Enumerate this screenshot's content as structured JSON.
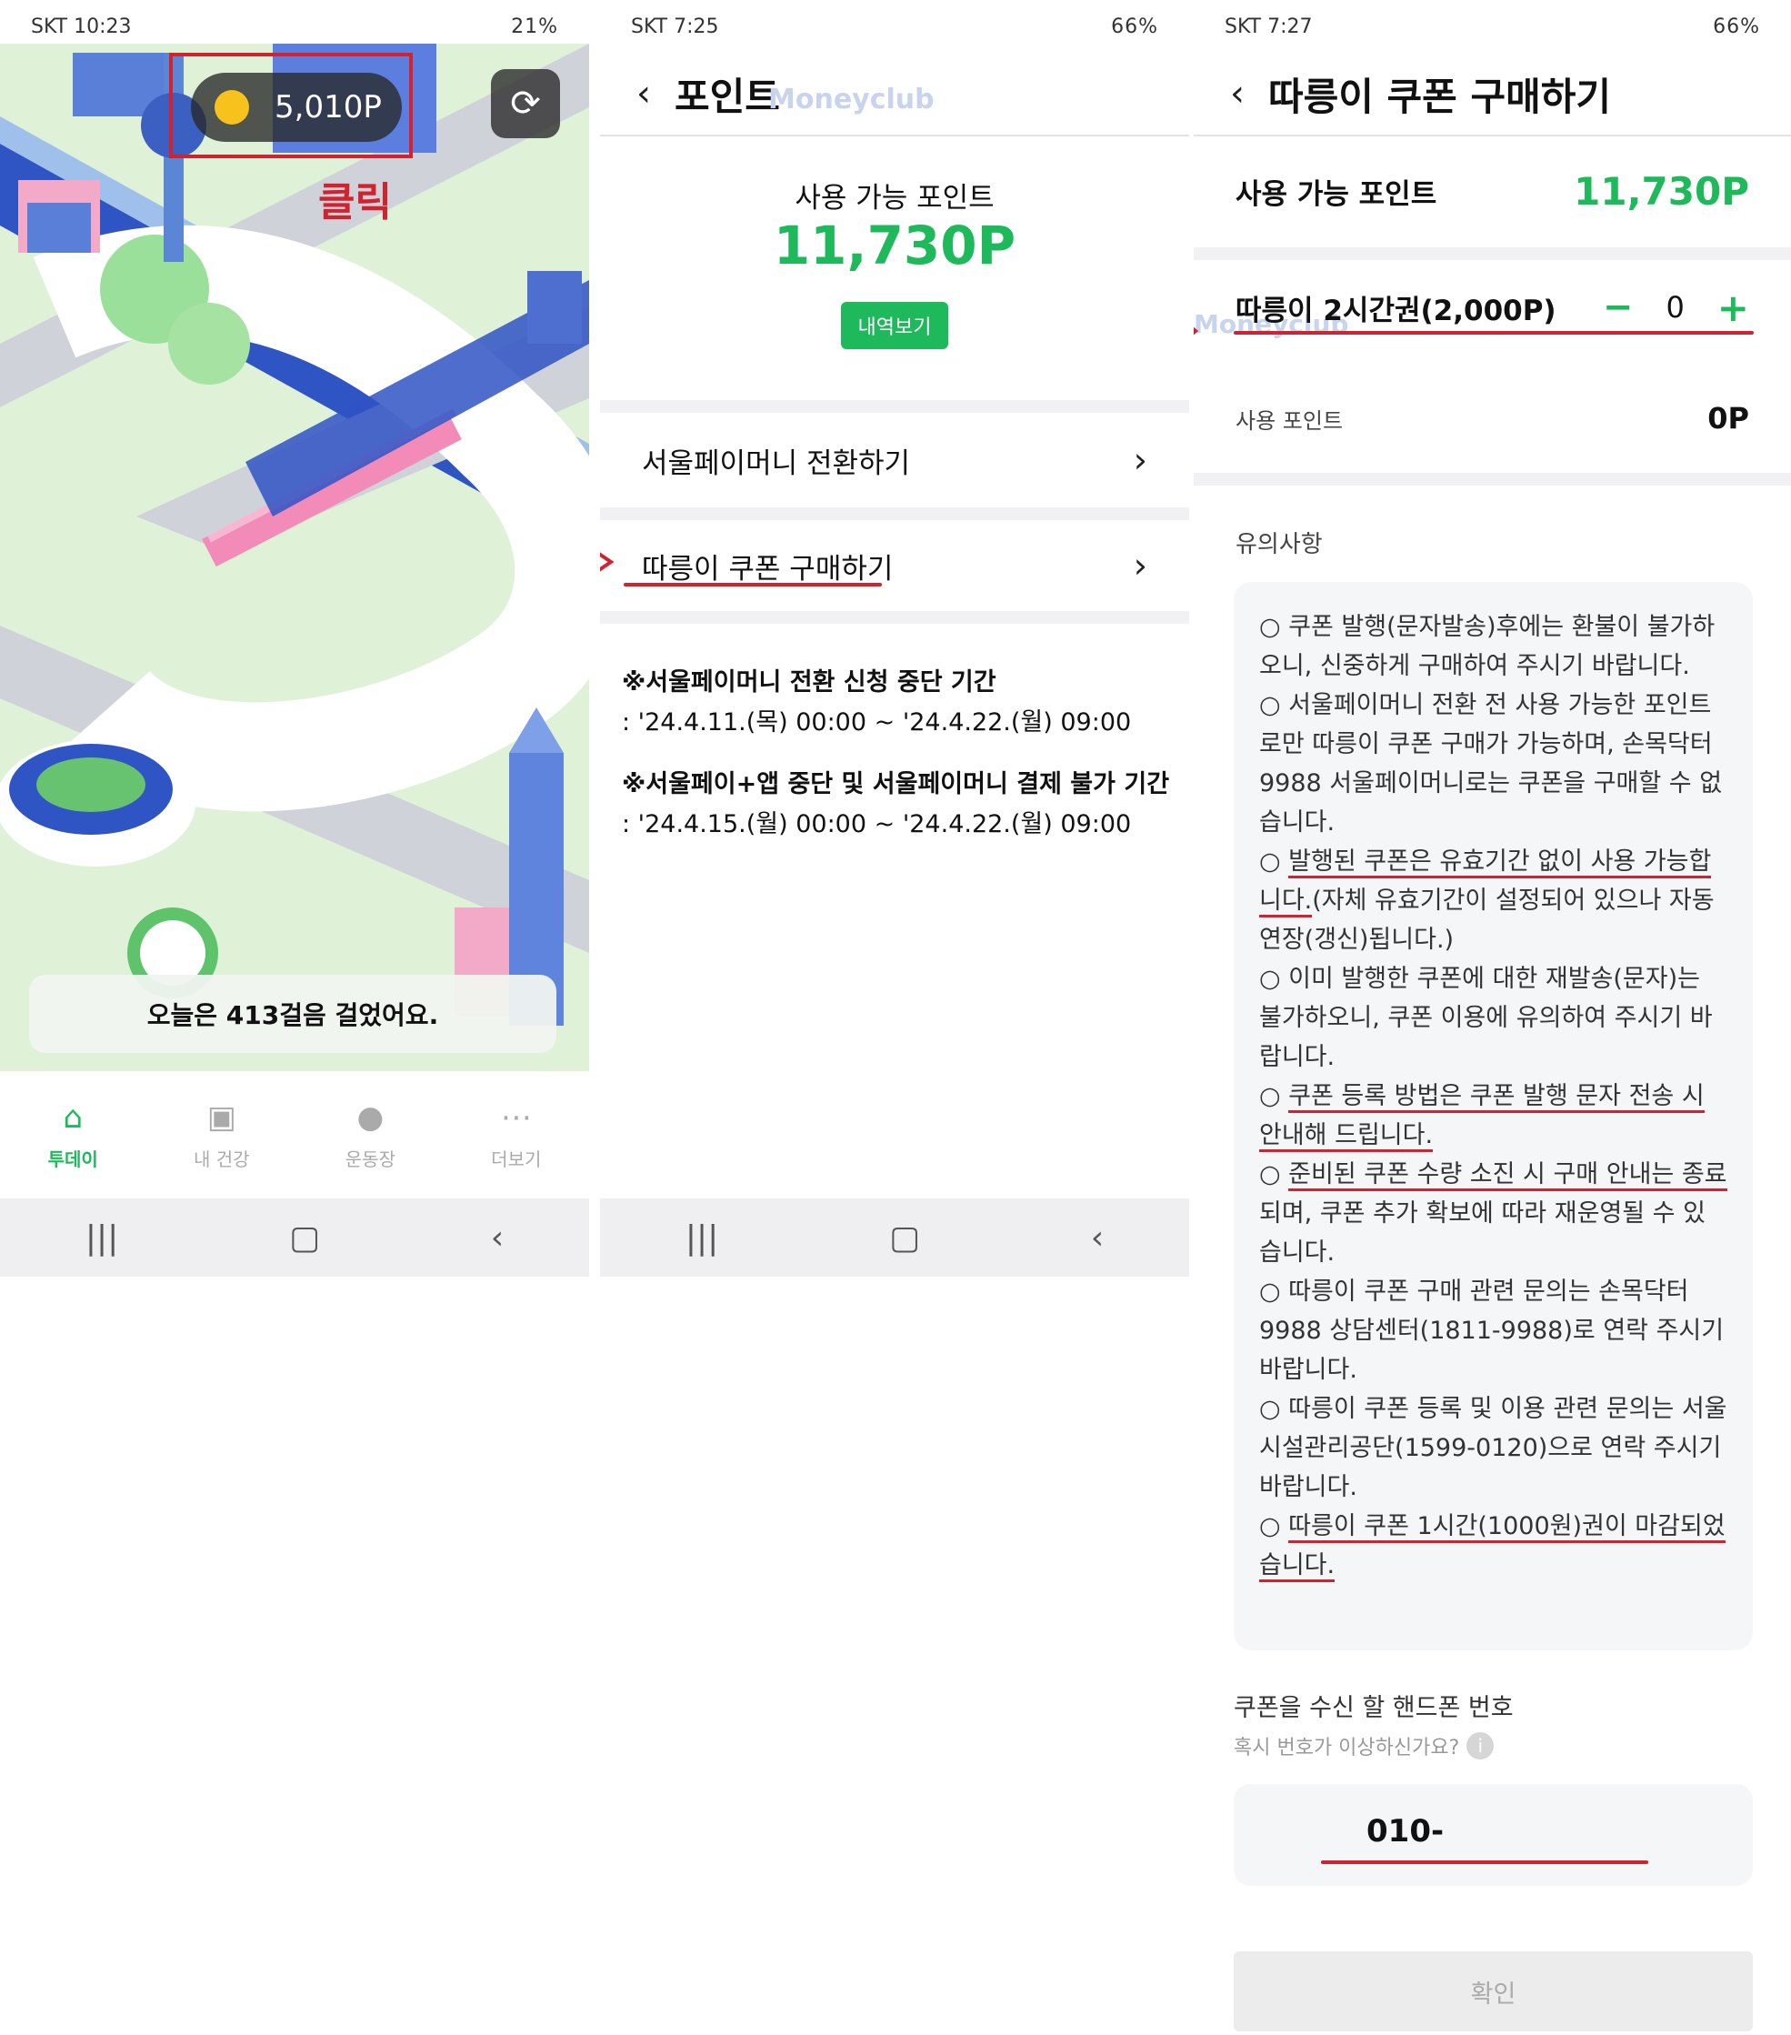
{
  "panel1": {
    "status": {
      "left": "SKT 10:23",
      "right": "21%"
    },
    "points": "5,010P",
    "click_label": "클릭",
    "steps_msg": "오늘은 413걸음 걸었어요.",
    "tabs": [
      {
        "icon": "home-icon",
        "label": "투데이"
      },
      {
        "icon": "health-icon",
        "label": "내 건강"
      },
      {
        "icon": "chat-icon",
        "label": "운동장"
      },
      {
        "icon": "more-icon",
        "label": "더보기"
      }
    ],
    "colors": {
      "accent": "#1db95a",
      "alert": "#d0222f"
    }
  },
  "panel2": {
    "status": {
      "left": "SKT 7:25",
      "right": "66%"
    },
    "title": "포인트",
    "available_label": "사용 가능 포인트",
    "available_value": "11,730P",
    "history_button": "내역보기",
    "menu": [
      {
        "label": "서울페이머니 전환하기"
      },
      {
        "label": "따릉이 쿠폰 구매하기"
      }
    ],
    "notice1_title": "※서울페이머니 전환 신청 중단 기간",
    "notice1_body": ": '24.4.11.(목) 00:00 ~ '24.4.22.(월) 09:00",
    "notice2_title": "※서울페이+앱 중단 및 서울페이머니 결제 불가 기간",
    "notice2_body": ": '24.4.15.(월) 00:00 ~ '24.4.22.(월) 09:00",
    "watermark": "Moneyclub"
  },
  "panel3": {
    "status": {
      "left": "SKT 7:27",
      "right": "66%"
    },
    "title": "따릉이 쿠폰 구매하기",
    "available_label": "사용 가능 포인트",
    "available_value": "11,730P",
    "ticket_label": "따릉이 2시간권(2,000P)",
    "minus": "−",
    "qty": "0",
    "plus": "+",
    "used_label": "사용 포인트",
    "used_value": "0P",
    "notice_title": "유의사항",
    "n1": "○ 쿠폰 발행(문자발송)후에는 환불이 불가하오니, 신중하게 구매하여 주시기 바랍니다.",
    "n2": "○ 서울페이머니 전환 전 사용 가능한 포인트로만 따릉이 쿠폰 구매가 가능하며, 손목닥터9988 서울페이머니로는 쿠폰을 구매할 수 없습니다.",
    "n3a": "○ ",
    "n3b": "발행된 쿠폰은 유효기간 없이 사용 가능합니다.",
    "n3c": "(자체 유효기간이 설정되어 있으나 자동 연장(갱신)됩니다.)",
    "n4": "○ 이미 발행한 쿠폰에 대한 재발송(문자)는 불가하오니, 쿠폰 이용에 유의하여 주시기 바랍니다.",
    "n5a": "○ ",
    "n5b": "쿠폰 등록 방법은 쿠폰 발행 문자 전송 시 안내해 드립니다.",
    "n6a": "○ ",
    "n6b": "준비된 쿠폰 수량 소진 시 구매 안내는 종료",
    "n6c": "되며, 쿠폰 추가 확보에 따라 재운영될 수 있습니다.",
    "n7": "○ 따릉이 쿠폰 구매 관련 문의는 손목닥터9988 상담센터(1811-9988)로 연락 주시기 바랍니다.",
    "n8": "○ 따릉이 쿠폰 등록 및 이용 관련 문의는 서울시설관리공단(1599-0120)으로 연락 주시기 바랍니다.",
    "n9a": "○ ",
    "n9b": "따릉이 쿠폰 1시간(1000원)권이 마감되었습니다.",
    "phone_label": "쿠폰을 수신 할 핸드폰 번호",
    "phone_hint": "혹시 번호가 이상하신가요?",
    "phone_value": "010-",
    "confirm": "확인",
    "watermark": "Moneyclub"
  }
}
